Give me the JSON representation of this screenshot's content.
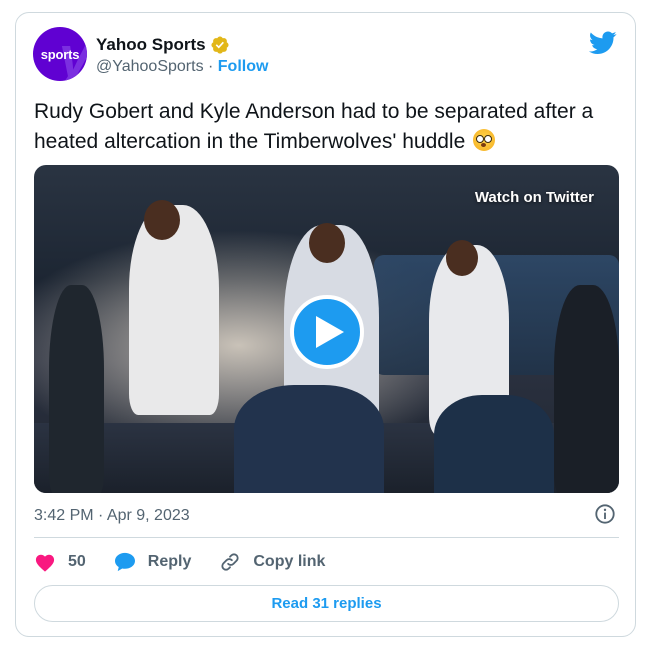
{
  "author": {
    "avatar_text": "sports",
    "name": "Yahoo Sports",
    "handle": "@YahooSports",
    "separator": " · ",
    "follow_label": "Follow"
  },
  "tweet": {
    "text": "Rudy Gobert and Kyle Anderson had to be separated after a heated altercation in the Timberwolves' huddle"
  },
  "media": {
    "watch_label": "Watch on Twitter"
  },
  "timestamp": "3:42 PM · Apr 9, 2023",
  "actions": {
    "like_count": "50",
    "reply_label": "Reply",
    "copy_link_label": "Copy link"
  },
  "read_replies_label": "Read 31 replies",
  "colors": {
    "accent": "#1d9bf0",
    "like": "#f91880",
    "brand_purple": "#6001d2",
    "verified_gold": "#e2b719",
    "muted": "#536471"
  },
  "icons": {
    "verified": "verified-badge-icon",
    "bird": "twitter-bird-icon",
    "play": "play-icon",
    "info": "info-icon",
    "like": "heart-icon",
    "reply": "speech-bubble-icon",
    "copy_link": "link-icon",
    "emoji": "flushed-face-emoji"
  }
}
